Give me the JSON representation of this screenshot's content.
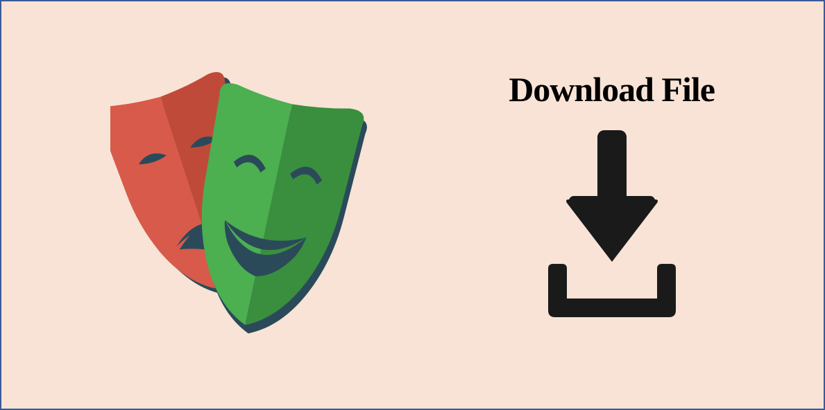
{
  "heading": "Download File",
  "colors": {
    "background": "#f8e3d6",
    "border": "#3a5a9a",
    "maskRedLight": "#d85a4a",
    "maskRedDark": "#c04a3a",
    "maskGreenLight": "#4caf50",
    "maskGreenDark": "#3a8f3e",
    "shadow": "#2a4a5a",
    "iconBlack": "#1a1a1a"
  }
}
